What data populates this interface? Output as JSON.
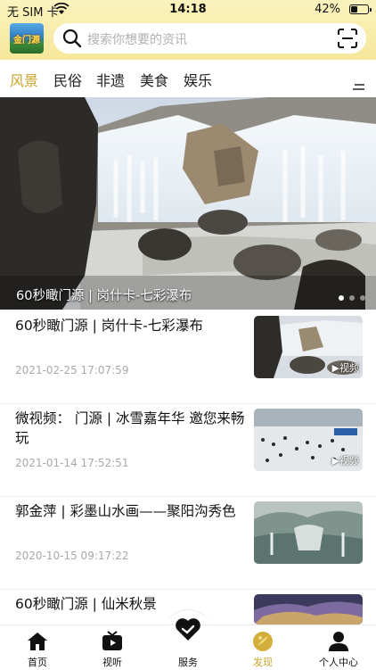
{
  "status": {
    "carrier": "无 SIM 卡",
    "time": "14:18",
    "battery_pct": "42%",
    "battery_level": 0.42
  },
  "header": {
    "logo_text": "金门源",
    "search_placeholder": "搜索你想要的资讯"
  },
  "categories": [
    "风景",
    "民俗",
    "非遗",
    "美食",
    "娱乐"
  ],
  "active_category": 0,
  "hero": {
    "caption": "60秒瞰门源 | 岗什卡-七彩瀑布",
    "slides": 3,
    "active_slide": 0
  },
  "articles": [
    {
      "title": "60秒瞰门源 | 岗什卡-七彩瀑布",
      "date": "2021-02-25 17:07:59",
      "badge": "视频"
    },
    {
      "title": "微视频： 门源 | 冰雪嘉年华 邀您来畅玩",
      "date": "2021-01-14 17:52:51",
      "badge": "视频"
    },
    {
      "title": "郭金萍 | 彩墨山水画——聚阳沟秀色",
      "date": "2020-10-15 09:17:22",
      "badge": ""
    },
    {
      "title": "60秒瞰门源 | 仙米秋景",
      "date": "",
      "badge": ""
    }
  ],
  "tabbar": [
    {
      "label": "首页",
      "icon": "home-icon"
    },
    {
      "label": "视听",
      "icon": "tv-icon"
    },
    {
      "label": "服务",
      "icon": "heart-icon"
    },
    {
      "label": "发现",
      "icon": "discover-icon"
    },
    {
      "label": "个人中心",
      "icon": "person-icon"
    }
  ],
  "colors": {
    "accent": "#c9a52b",
    "header_bg": "#f6e79a"
  }
}
